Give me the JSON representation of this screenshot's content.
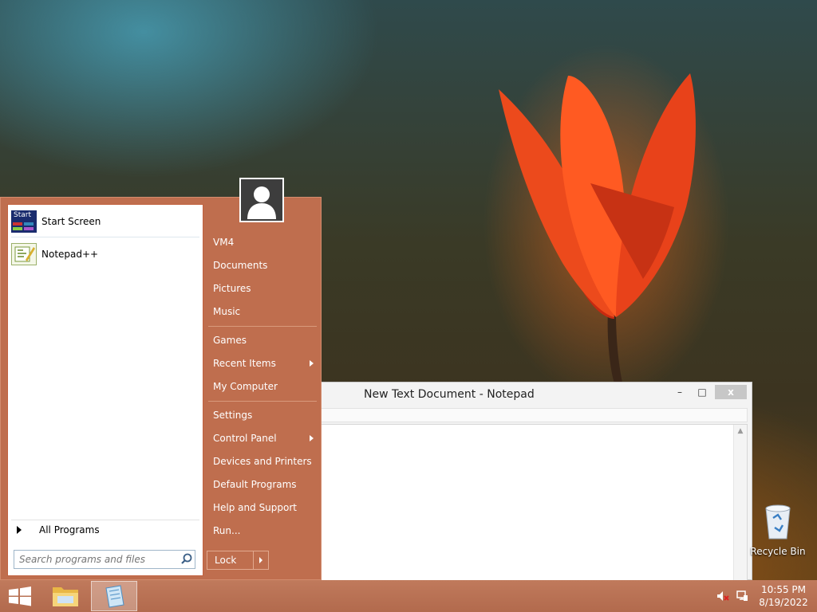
{
  "notepad": {
    "title": "New Text Document - Notepad",
    "minimize_glyph": "–",
    "maximize_glyph": "□",
    "close_glyph": "x"
  },
  "start_menu": {
    "programs": [
      {
        "label": "Start Screen",
        "icon": "start-screen-icon",
        "icon_text": "Start"
      },
      {
        "label": "Notepad++",
        "icon": "notepad-plus-plus-icon"
      }
    ],
    "all_programs": "All Programs",
    "search_placeholder": "Search programs and files",
    "right_items": [
      {
        "label": "VM4"
      },
      {
        "label": "Documents"
      },
      {
        "label": "Pictures"
      },
      {
        "label": "Music"
      },
      {
        "label": "Games"
      },
      {
        "label": "Recent Items",
        "submenu": true
      },
      {
        "label": "My Computer"
      },
      {
        "label": "Settings"
      },
      {
        "label": "Control Panel",
        "submenu": true
      },
      {
        "label": "Devices and Printers"
      },
      {
        "label": "Default Programs"
      },
      {
        "label": "Help and Support"
      },
      {
        "label": "Run..."
      }
    ],
    "lock_label": "Lock"
  },
  "desktop": {
    "recycle_bin_label": "Recycle Bin"
  },
  "taskbar": {
    "time": "10:55 PM",
    "date": "8/19/2022",
    "tray_icons": [
      "volume-muted-icon",
      "network-icon"
    ]
  },
  "colors": {
    "start_menu_accent": "#bf6e4e",
    "taskbar": "#b8704f"
  }
}
